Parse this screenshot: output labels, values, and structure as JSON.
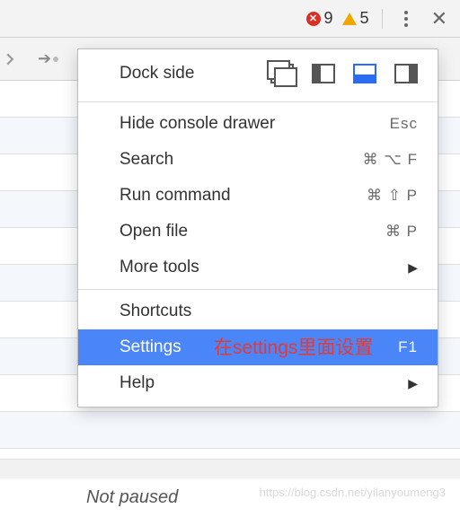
{
  "toolbar": {
    "errors": "9",
    "warnings": "5"
  },
  "menu": {
    "dock_label": "Dock side",
    "hide_drawer": "Hide console drawer",
    "hide_drawer_key": "Esc",
    "search": "Search",
    "search_key": "⌘ ⌥ F",
    "run_command": "Run command",
    "run_command_key": "⌘ ⇧ P",
    "open_file": "Open file",
    "open_file_key": "⌘ P",
    "more_tools": "More tools",
    "shortcuts": "Shortcuts",
    "settings": "Settings",
    "settings_key": "F1",
    "help": "Help"
  },
  "annotation": "在settings里面设置",
  "status_text": "Not paused",
  "watermark": "https://blog.csdn.net/yilanyoumeng3"
}
